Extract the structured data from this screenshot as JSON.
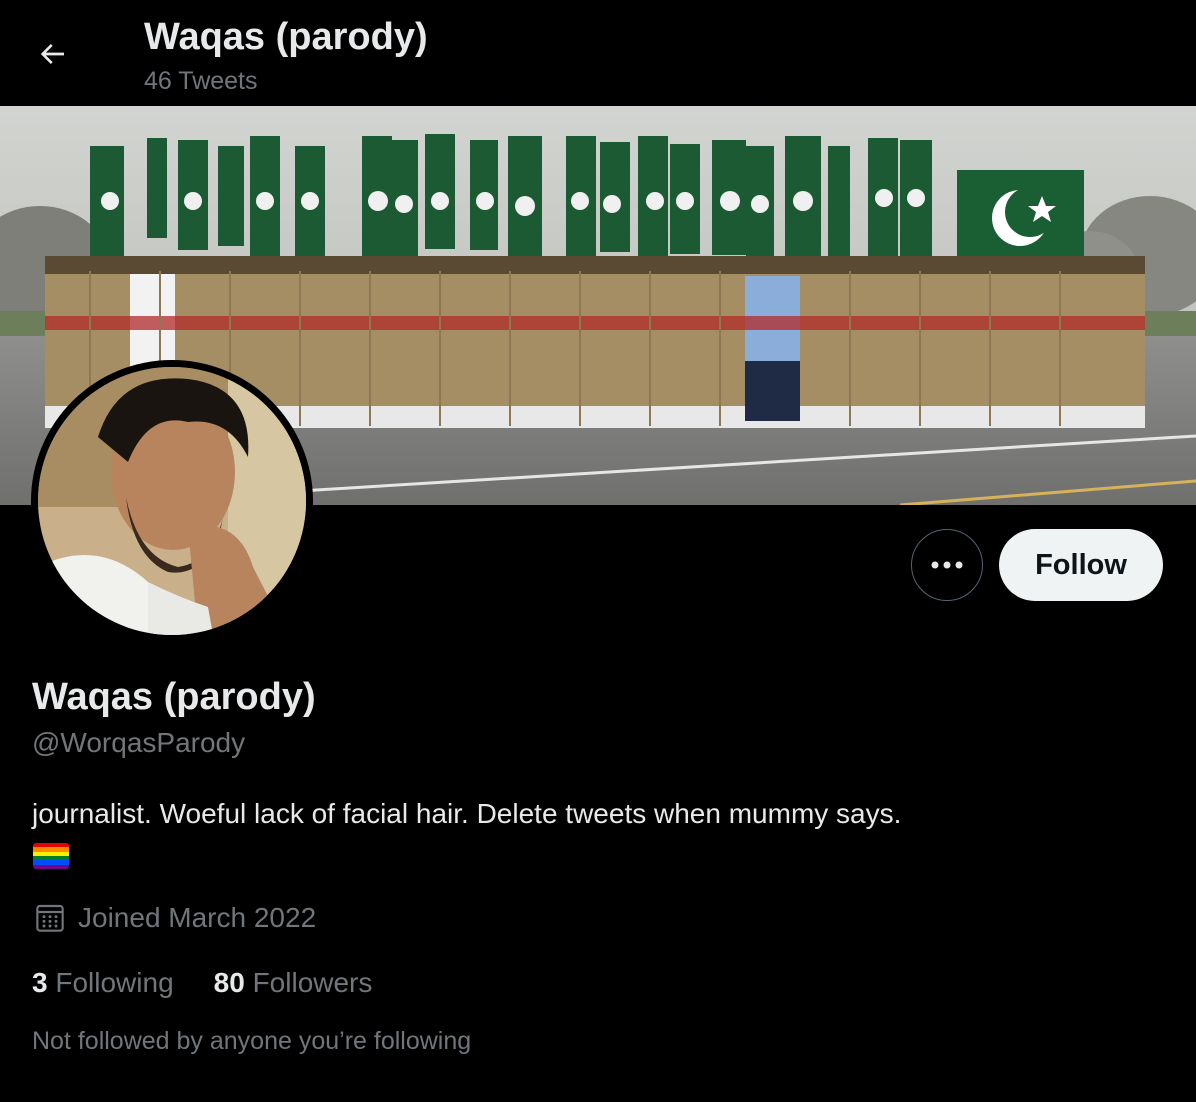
{
  "header": {
    "back_icon": "arrow-left-icon",
    "title": "Waqas (parody)",
    "tweet_count": "46 Tweets"
  },
  "banner": {
    "description_icon": "military-parade-banner-image"
  },
  "profile": {
    "avatar_icon": "profile-photo-avatar",
    "name": "Waqas (parody)",
    "handle": "@WorqasParody",
    "bio": "journalist. Woeful lack of facial hair. Delete tweets when mummy says.",
    "bio_emoji_icon": "rainbow-flag-icon",
    "joined_icon": "calendar-icon",
    "joined": "Joined March 2022",
    "following_count": "3",
    "following_label": "Following",
    "followers_count": "80",
    "followers_label": "Followers",
    "followed_by_note": "Not followed by anyone you’re following"
  },
  "actions": {
    "more_icon": "more-horizontal-icon",
    "follow_label": "Follow"
  },
  "colors": {
    "background": "#000000",
    "primary_text": "#e7e9ea",
    "secondary_text": "#71767b",
    "follow_button_bg": "#eff3f4",
    "follow_button_text": "#0f1419",
    "border": "#536471"
  }
}
